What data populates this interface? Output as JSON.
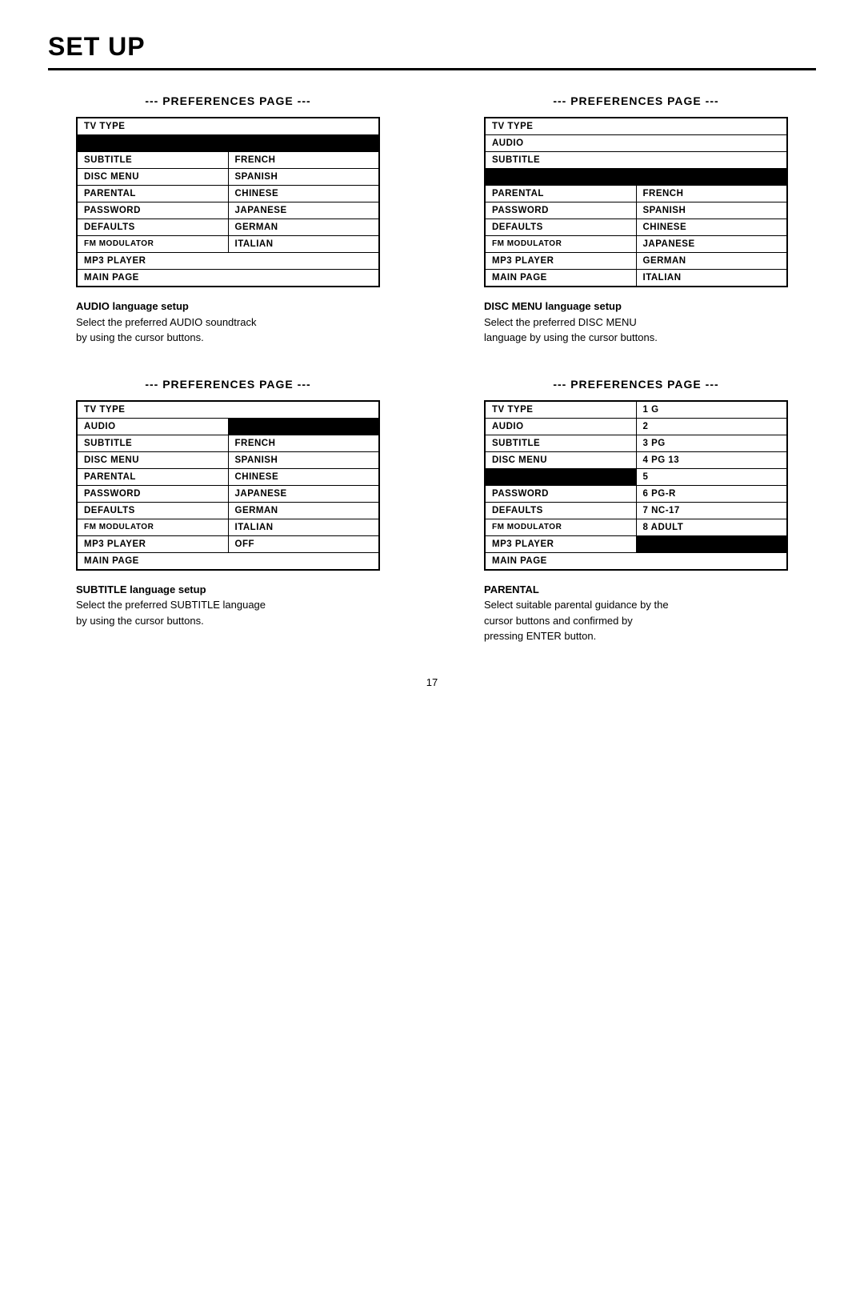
{
  "title": "SET UP",
  "page_number": "17",
  "sections": [
    {
      "id": "audio-section",
      "header": "--- PREFERENCES PAGE ---",
      "rows": [
        {
          "col1": "TV TYPE",
          "col2": null,
          "col1_black": false,
          "col2_black": false
        },
        {
          "col1": null,
          "col2": null,
          "col1_black": true,
          "col2_black": true
        },
        {
          "col1": "SUBTITLE",
          "col2": "FRENCH",
          "col1_black": false,
          "col2_black": false
        },
        {
          "col1": "DISC MENU",
          "col2": "SPANISH",
          "col1_black": false,
          "col2_black": false
        },
        {
          "col1": "PARENTAL",
          "col2": "CHINESE",
          "col1_black": false,
          "col2_black": false
        },
        {
          "col1": "PASSWORD",
          "col2": "JAPANESE",
          "col1_black": false,
          "col2_black": false
        },
        {
          "col1": "DEFAULTS",
          "col2": "GERMAN",
          "col1_black": false,
          "col2_black": false
        },
        {
          "col1": "FM MODULATOR",
          "col2": "ITALIAN",
          "col1_black": false,
          "col2_black": false
        },
        {
          "col1": "MP3 PLAYER",
          "col2": null,
          "col1_black": false,
          "col2_black": false
        },
        {
          "col1": "MAIN PAGE",
          "col2": null,
          "col1_black": false,
          "col2_black": false
        }
      ],
      "desc_title": "AUDIO language setup",
      "desc_lines": [
        "Select the preferred AUDIO soundtrack",
        "by using the cursor buttons."
      ]
    },
    {
      "id": "discmenu-section",
      "header": "--- PREFERENCES PAGE ---",
      "rows": [
        {
          "col1": "TV TYPE",
          "col2": null,
          "col1_black": false,
          "col2_black": false
        },
        {
          "col1": "AUDIO",
          "col2": null,
          "col1_black": false,
          "col2_black": false
        },
        {
          "col1": "SUBTITLE",
          "col2": null,
          "col1_black": false,
          "col2_black": false
        },
        {
          "col1": null,
          "col2": null,
          "col1_black": true,
          "col2_black": true
        },
        {
          "col1": "PARENTAL",
          "col2": "FRENCH",
          "col1_black": false,
          "col2_black": false
        },
        {
          "col1": "PASSWORD",
          "col2": "SPANISH",
          "col1_black": false,
          "col2_black": false
        },
        {
          "col1": "DEFAULTS",
          "col2": "CHINESE",
          "col1_black": false,
          "col2_black": false
        },
        {
          "col1": "FM MODULATOR",
          "col2": "JAPANESE",
          "col1_black": false,
          "col2_black": false
        },
        {
          "col1": "MP3 PLAYER",
          "col2": "GERMAN",
          "col1_black": false,
          "col2_black": false
        },
        {
          "col1": "MAIN PAGE",
          "col2": "ITALIAN",
          "col1_black": false,
          "col2_black": false
        }
      ],
      "desc_title": "DISC MENU language setup",
      "desc_lines": [
        "Select the preferred DISC MENU",
        "language by using the cursor buttons."
      ]
    },
    {
      "id": "subtitle-section",
      "header": "--- PREFERENCES PAGE ---",
      "rows": [
        {
          "col1": "TV TYPE",
          "col2": null,
          "col1_black": false,
          "col2_black": false
        },
        {
          "col1": "AUDIO",
          "col2": null,
          "col1_black": false,
          "col2_black": true
        },
        {
          "col1": "SUBTITLE",
          "col2": "FRENCH",
          "col1_black": false,
          "col2_black": false
        },
        {
          "col1": "DISC MENU",
          "col2": "SPANISH",
          "col1_black": false,
          "col2_black": false
        },
        {
          "col1": "PARENTAL",
          "col2": "CHINESE",
          "col1_black": false,
          "col2_black": false
        },
        {
          "col1": "PASSWORD",
          "col2": "JAPANESE",
          "col1_black": false,
          "col2_black": false
        },
        {
          "col1": "DEFAULTS",
          "col2": "GERMAN",
          "col1_black": false,
          "col2_black": false
        },
        {
          "col1": "FM MODULATOR",
          "col2": "ITALIAN",
          "col1_black": false,
          "col2_black": false
        },
        {
          "col1": "MP3 PLAYER",
          "col2": "OFF",
          "col1_black": false,
          "col2_black": false
        },
        {
          "col1": "MAIN PAGE",
          "col2": null,
          "col1_black": false,
          "col2_black": false
        }
      ],
      "desc_title": "SUBTITLE language setup",
      "desc_lines": [
        "Select the preferred SUBTITLE language",
        "by using the cursor buttons."
      ]
    },
    {
      "id": "parental-section",
      "header": "--- PREFERENCES PAGE ---",
      "rows": [
        {
          "col1": "TV TYPE",
          "col2": "1 G",
          "col1_black": false,
          "col2_black": false
        },
        {
          "col1": "AUDIO",
          "col2": "2",
          "col1_black": false,
          "col2_black": false
        },
        {
          "col1": "SUBTITLE",
          "col2": "3 PG",
          "col1_black": false,
          "col2_black": false
        },
        {
          "col1": "DISC MENU",
          "col2": "4 PG 13",
          "col1_black": false,
          "col2_black": false
        },
        {
          "col1": null,
          "col2": "5",
          "col1_black": true,
          "col2_black": false
        },
        {
          "col1": "PASSWORD",
          "col2": "6 PG-R",
          "col1_black": false,
          "col2_black": false
        },
        {
          "col1": "DEFAULTS",
          "col2": "7 NC-17",
          "col1_black": false,
          "col2_black": false
        },
        {
          "col1": "FM MODULATOR",
          "col2": "8 ADULT",
          "col1_black": false,
          "col2_black": false
        },
        {
          "col1": "MP3 PLAYER",
          "col2": null,
          "col1_black": false,
          "col2_black": true
        },
        {
          "col1": "MAIN PAGE",
          "col2": null,
          "col1_black": false,
          "col2_black": false
        }
      ],
      "desc_title": "PARENTAL",
      "desc_lines": [
        "Select suitable parental guidance by the",
        "cursor buttons and confirmed by",
        "pressing ENTER button."
      ]
    }
  ]
}
